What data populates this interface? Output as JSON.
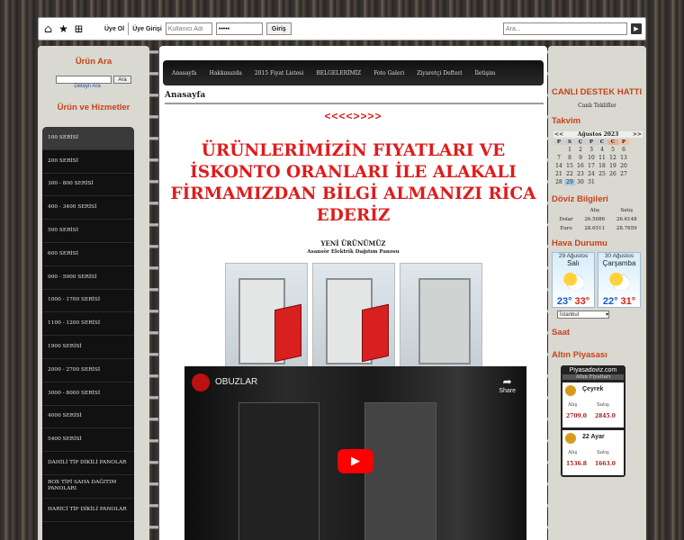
{
  "topbar": {
    "register": "Üye Ol",
    "login_label": "Üye Girişi",
    "username_placeholder": "Kullanıcı Adı",
    "password_value": "•••••",
    "login_button": "Giriş",
    "search_placeholder": "Ara..."
  },
  "left": {
    "product_search_title": "Ürün Ara",
    "search_button": "Ara",
    "advanced_search": "Detaylı Ara",
    "products_title": "Ürün ve Hizmetler",
    "menu": [
      "100 SERİSİ",
      "200 SERİSİ",
      "300 - 800 SERİSİ",
      "400 - 3400 SERİSİ",
      "500 SERİSİ",
      "600 SERİSİ",
      "900 - 5900 SERİSİ",
      "1000 - 1700 SERİSİ",
      "1100 - 1200 SERİSİ",
      "1900 SERİSİ",
      "2000 - 2700 SERİSİ",
      "3000 - 8000 SERİSİ",
      "4000 SERİSİ",
      "5400 SERİSİ",
      "DAHİLİ TİP DİKİLİ PANOLAR",
      "BOX TİPİ SAHA DAĞITIM PANOLARI",
      "HARİCİ TİP DİKİLİ PANOLAR"
    ]
  },
  "nav": [
    "Anasayfa",
    "Hakkımızda",
    "2015 Fiyat Listesi",
    "BELGELERİMİZ",
    "Foto Galeri",
    "Ziyaretçi Defteri",
    "İletişim"
  ],
  "main": {
    "title": "Anasayfa",
    "marquee": "<<<<>>>>",
    "headline": "ÜRÜNLERİMİZİN  FIYATLARI VE İSKONTO ORANLARI İLE ALAKALI  FİRMAMIZDAN BİLGİ ALMANIZI RİCA EDERİZ",
    "new_title": "YENİ ÜRÜNÜMÜZ",
    "new_subtitle": "Asansör Elektrik Dağıtım Panosu",
    "video": {
      "channel": "OBUZLAR",
      "share": "Share"
    }
  },
  "right": {
    "support_title": "CANLI DESTEK HATTI",
    "support_link": "Canlı Teklifler",
    "calendar_title": "Takvim",
    "calendar": {
      "prev": "<<",
      "next": ">>",
      "month": "Ağustos 2023",
      "days": [
        "P",
        "S",
        "Ç",
        "P",
        "C",
        "C",
        "P"
      ],
      "weeks": [
        [
          "",
          "1",
          "2",
          "3",
          "4",
          "5",
          "6"
        ],
        [
          "7",
          "8",
          "9",
          "10",
          "11",
          "12",
          "13"
        ],
        [
          "14",
          "15",
          "16",
          "17",
          "18",
          "19",
          "20"
        ],
        [
          "21",
          "22",
          "23",
          "24",
          "25",
          "26",
          "27"
        ],
        [
          "28",
          "29",
          "30",
          "31",
          "",
          "",
          ""
        ]
      ],
      "today": "29"
    },
    "currency_title": "Döviz Bilgileri",
    "currency": {
      "headers": [
        "",
        "Alış",
        "Satış"
      ],
      "rows": [
        [
          "Dolar",
          "26.5086",
          "26.6148"
        ],
        [
          "Euro",
          "28.6511",
          "28.7659"
        ]
      ]
    },
    "weather_title": "Hava Durumu",
    "weather": [
      {
        "date": "29 Ağustos",
        "day": "Salı",
        "low": "23°",
        "high": "33°"
      },
      {
        "date": "30 Ağustos",
        "day": "Çarşamba",
        "low": "22°",
        "high": "31°"
      }
    ],
    "city": "İstanbul",
    "clock_title": "Saat",
    "gold_title": "Altın Piyasası",
    "gold": {
      "site": "Piyasadoviz.com",
      "sub": "Altın Fiyatları",
      "items": [
        {
          "name": "Çeyrek",
          "buy_label": "Alış",
          "sell_label": "Satış",
          "buy": "2709.0",
          "sell": "2845.0"
        },
        {
          "name": "22 Ayar",
          "buy_label": "Alış",
          "sell_label": "Satış",
          "buy": "1536.8",
          "sell": "1663.0"
        }
      ]
    }
  }
}
